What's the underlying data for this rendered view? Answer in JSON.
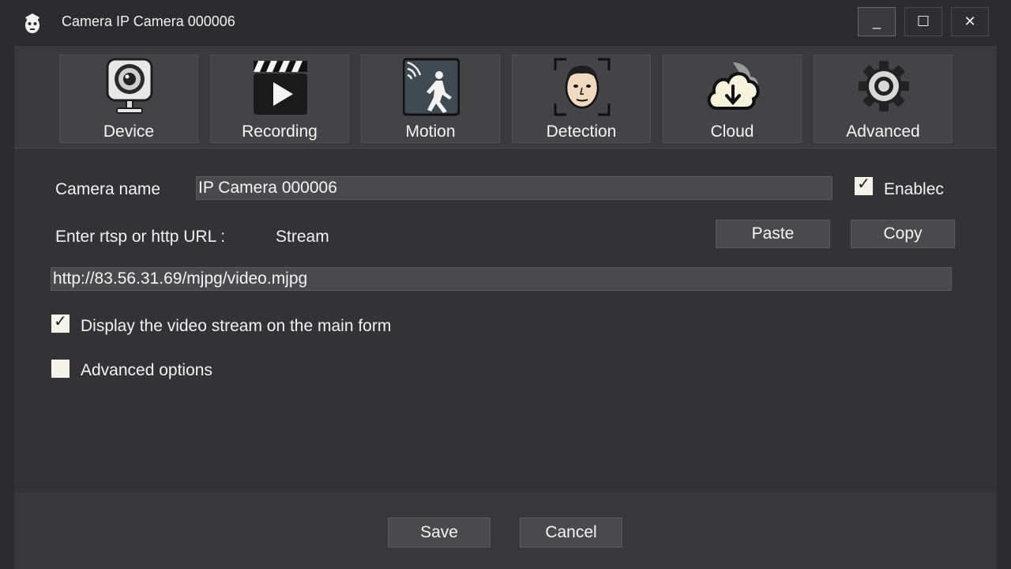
{
  "titlebar": {
    "icon": "app-logo-icon",
    "title": "Camera IP Camera 000006",
    "minimize": "_",
    "maximize": "☐",
    "close": "✕"
  },
  "toolbar": {
    "items": [
      {
        "label": "Device",
        "icon": "webcam-icon"
      },
      {
        "label": "Recording",
        "icon": "clapperboard-play-icon"
      },
      {
        "label": "Motion",
        "icon": "motion-sensor-icon"
      },
      {
        "label": "Detection",
        "icon": "face-detection-icon"
      },
      {
        "label": "Cloud",
        "icon": "cloud-download-icon"
      },
      {
        "label": "Advanced",
        "icon": "gear-icon"
      }
    ]
  },
  "form": {
    "camera_name_label": "Camera name",
    "camera_name_value": "IP Camera 000006",
    "enabled_label": "Enablec",
    "enabled_checked": "✓",
    "url_label": "Enter rtsp or http URL :",
    "stream_label": "Stream",
    "paste_label": "Paste",
    "copy_label": "Copy",
    "url_value": "http://83.56.31.69/mjpg/video.mjpg",
    "display_stream_label": "Display the video stream on the main form",
    "display_stream_checked": "✓",
    "advanced_options_label": "Advanced options",
    "advanced_options_checked": ""
  },
  "footer": {
    "save_label": "Save",
    "cancel_label": "Cancel"
  }
}
